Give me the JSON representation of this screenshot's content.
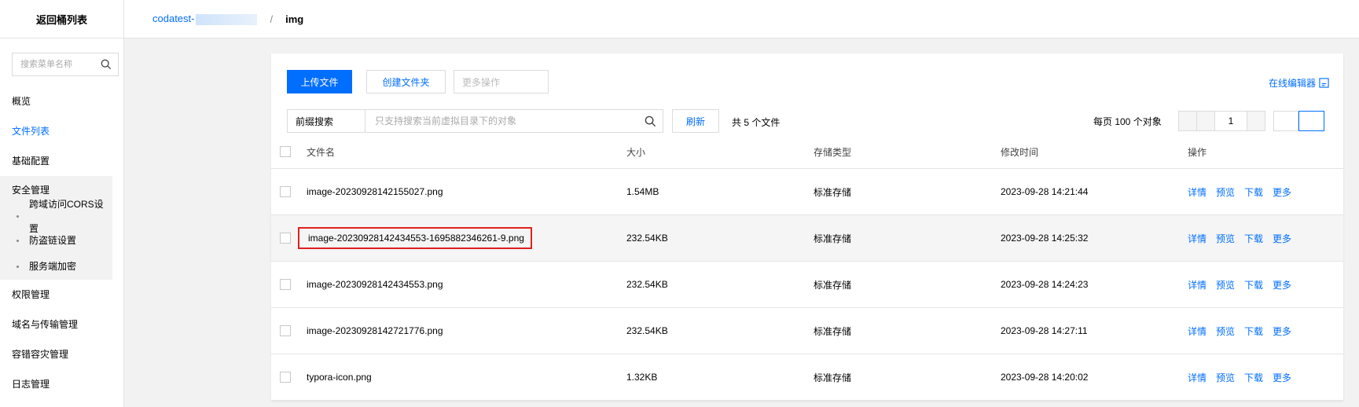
{
  "sidebar": {
    "back_label": "返回桶列表",
    "search_placeholder": "搜索菜单名称",
    "items": [
      {
        "label": "概览"
      },
      {
        "label": "文件列表"
      },
      {
        "label": "基础配置"
      },
      {
        "label": "安全管理"
      },
      {
        "label": "权限管理"
      },
      {
        "label": "域名与传输管理"
      },
      {
        "label": "容错容灾管理"
      },
      {
        "label": "日志管理"
      }
    ],
    "security_sub": [
      {
        "label": "跨域访问CORS设置"
      },
      {
        "label": "防盗链设置"
      },
      {
        "label": "服务端加密"
      }
    ]
  },
  "breadcrumb": {
    "bucket": "codatest-",
    "separator": "/",
    "current": "img"
  },
  "toolbar": {
    "upload": "上传文件",
    "create_folder": "创建文件夹",
    "more_ops": "更多操作",
    "online_editor": "在线编辑器"
  },
  "filter": {
    "mode": "前缀搜索",
    "placeholder": "只支持搜索当前虚拟目录下的对象",
    "refresh": "刷新",
    "count_text": "共 5 个文件"
  },
  "pagination": {
    "per_page": "每页 100 个对象",
    "page": "1"
  },
  "table": {
    "headers": [
      "文件名",
      "大小",
      "存储类型",
      "修改时间",
      "操作"
    ],
    "actions": [
      "详情",
      "预览",
      "下载",
      "更多"
    ],
    "rows": [
      {
        "name": "image-20230928142155027.png",
        "size": "1.54MB",
        "storage": "标准存储",
        "modified": "2023-09-28 14:21:44"
      },
      {
        "name": "image-20230928142434553-1695882346261-9.png",
        "size": "232.54KB",
        "storage": "标准存储",
        "modified": "2023-09-28 14:25:32"
      },
      {
        "name": "image-20230928142434553.png",
        "size": "232.54KB",
        "storage": "标准存储",
        "modified": "2023-09-28 14:24:23"
      },
      {
        "name": "image-20230928142721776.png",
        "size": "232.54KB",
        "storage": "标准存储",
        "modified": "2023-09-28 14:27:11"
      },
      {
        "name": "typora-icon.png",
        "size": "1.32KB",
        "storage": "标准存储",
        "modified": "2023-09-28 14:20:02"
      }
    ]
  },
  "colors": {
    "primary": "#006eff",
    "highlight_border": "#e02020"
  }
}
